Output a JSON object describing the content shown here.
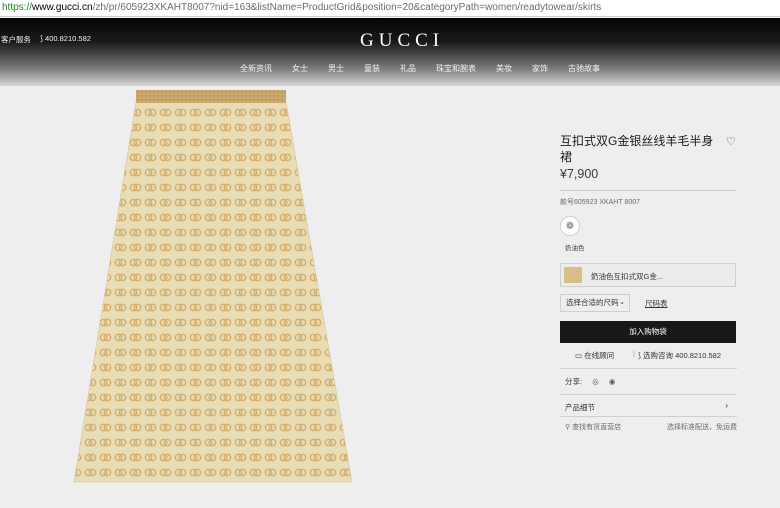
{
  "browser": {
    "scheme": "https://",
    "host": "www.gucci.cn",
    "path": "/zh/pr/605923XKAHT8007?nid=163&listName=ProductGrid&position=20&categoryPath=women/readytowear/skirts"
  },
  "header": {
    "service": "客户服务",
    "phone": "400.8210.582",
    "logo": "GUCCI",
    "nav": [
      "全新资讯",
      "女士",
      "男士",
      "童装",
      "礼品",
      "珠宝和腕表",
      "美妆",
      "家饰",
      "古驰故事"
    ]
  },
  "product": {
    "title": "互扣式双G金银丝线羊毛半身裙",
    "price": "¥7,900",
    "sku": "款号605923 XKAHT 8007",
    "swatch_label": "奶油色",
    "color_name": "奶油色互扣式双G金...",
    "size_select": "选择合适的尺码",
    "size_guide": "尺码表",
    "add_to_cart": "加入购物袋",
    "chat": "在线顾问",
    "call": "选购咨询 400.8210.582",
    "share_label": "分享:",
    "details": "产品细节",
    "store_search": "查找有货直营店",
    "shipping": "选择标准配送，免运费"
  },
  "icons": {
    "heart": "heart-icon",
    "chat": "chat-icon",
    "phone": "phone-icon",
    "wechat": "wechat-icon",
    "weibo": "weibo-icon",
    "location": "location-pin-icon",
    "chevron": "chevron-icon"
  },
  "colors": {
    "skirt_base": "#e8ddb5",
    "skirt_pattern": "#d3ae6f",
    "waistband": "#c9a468",
    "cart_button": "#181818"
  }
}
